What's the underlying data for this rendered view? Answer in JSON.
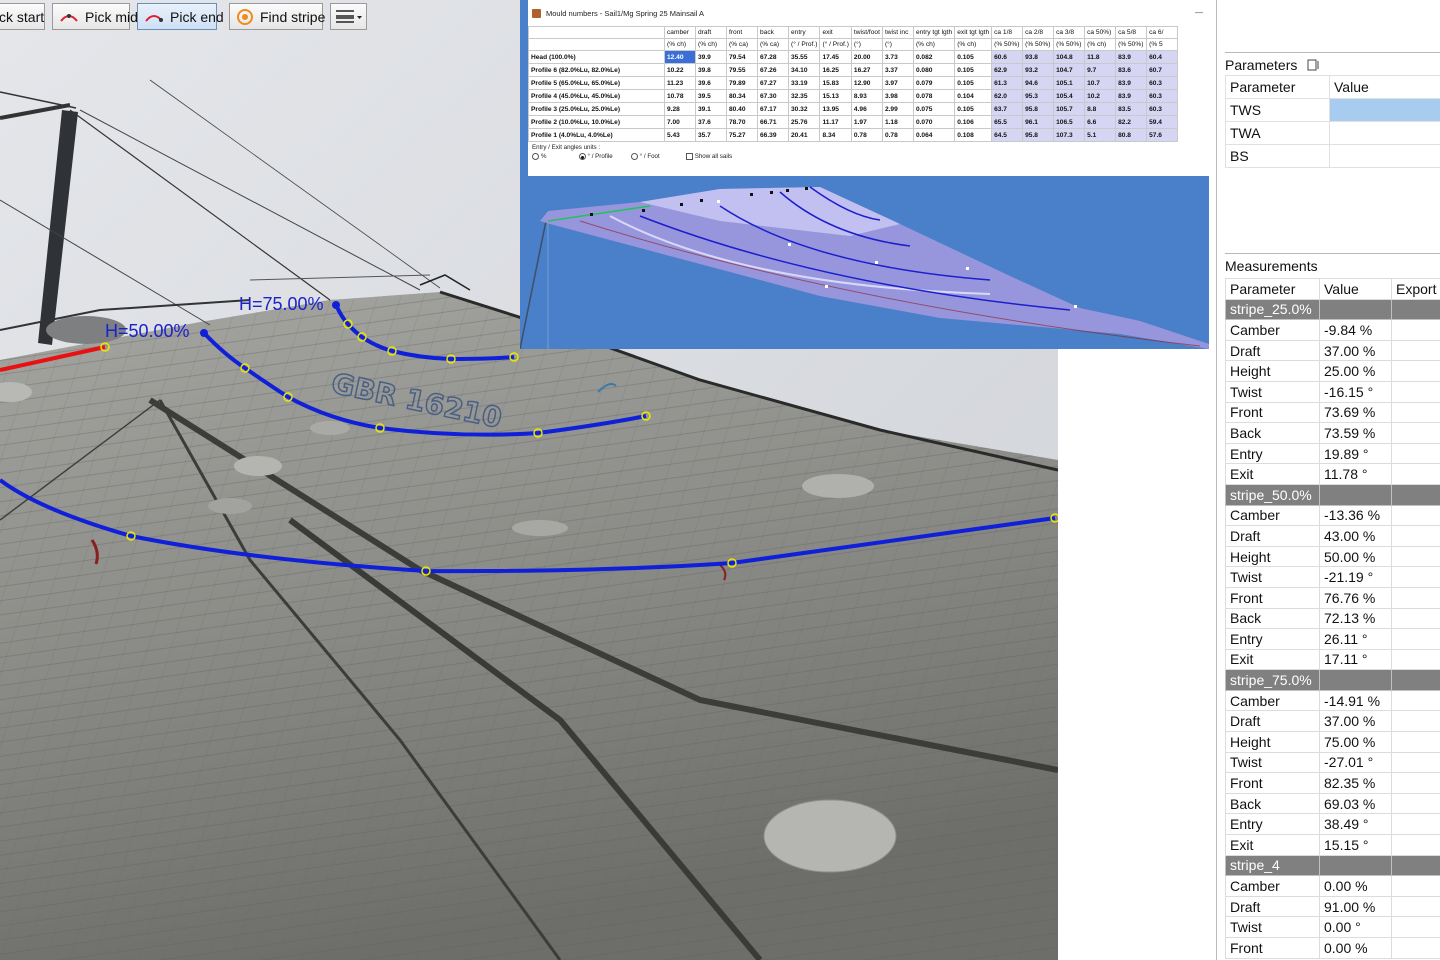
{
  "toolbar": {
    "buttons": [
      {
        "label": "ck start"
      },
      {
        "label": "Pick mid"
      },
      {
        "label": "Pick end",
        "active": true
      },
      {
        "label": "Find stripe"
      }
    ]
  },
  "overlay_labels": {
    "h50": "H=50.00%",
    "h75": "H=75.00%"
  },
  "sail_number_text": "GBR 16210",
  "colors": {
    "stripe_line": "#1020d8",
    "foot_line": "#e81010",
    "control_point": "#f2f200",
    "panel_group": "#808080",
    "selected_value": "#a8ccf0"
  },
  "mould_window": {
    "title": "Mould numbers - Sail1/Mg Spring 25 Mainsail A",
    "minimize": "—",
    "headers": [
      "camber",
      "draft",
      "front",
      "back",
      "entry",
      "exit",
      "twist/foot",
      "twist inc",
      "entry tgt lgth",
      "exit tgt lgth",
      "ca 1/8",
      "ca 2/8",
      "ca 3/8",
      "ca 50%)",
      "ca 5/8",
      "ca 6/"
    ],
    "units": [
      "(% ch)",
      "(% ch)",
      "(% ca)",
      "(% ca)",
      "(° / Prof.)",
      "(° / Prof.)",
      "(°)",
      "(°)",
      "(% ch)",
      "(% ch)",
      "(% 50%)",
      "(% 50%)",
      "(% 50%)",
      "(% ch)",
      "(% 50%)",
      "(% 5"
    ],
    "rows": [
      {
        "label": "Head (100.0%)",
        "values": [
          "12.40",
          "39.9",
          "79.54",
          "67.28",
          "35.55",
          "17.45",
          "20.00",
          "3.73",
          "0.082",
          "0.105",
          "60.6",
          "93.8",
          "104.8",
          "11.8",
          "83.9",
          "60.4"
        ]
      },
      {
        "label": "Profile 6 (82.0%Lu, 82.0%Le)",
        "values": [
          "10.22",
          "39.8",
          "79.55",
          "67.26",
          "34.10",
          "16.25",
          "16.27",
          "3.37",
          "0.080",
          "0.105",
          "62.9",
          "93.2",
          "104.7",
          "9.7",
          "83.6",
          "60.7"
        ]
      },
      {
        "label": "Profile 5 (65.0%Lu, 65.0%Le)",
        "values": [
          "11.23",
          "39.6",
          "79.89",
          "67.27",
          "33.19",
          "15.83",
          "12.90",
          "3.97",
          "0.079",
          "0.105",
          "61.3",
          "94.6",
          "105.1",
          "10.7",
          "83.9",
          "60.3"
        ]
      },
      {
        "label": "Profile 4 (45.0%Lu, 45.0%Le)",
        "values": [
          "10.78",
          "39.5",
          "80.34",
          "67.30",
          "32.35",
          "15.13",
          "8.93",
          "3.98",
          "0.078",
          "0.104",
          "62.0",
          "95.3",
          "105.4",
          "10.2",
          "83.9",
          "60.3"
        ]
      },
      {
        "label": "Profile 3 (25.0%Lu, 25.0%Le)",
        "values": [
          "9.28",
          "39.1",
          "80.40",
          "67.17",
          "30.32",
          "13.95",
          "4.96",
          "2.99",
          "0.075",
          "0.105",
          "63.7",
          "95.8",
          "105.7",
          "8.8",
          "83.5",
          "60.3"
        ]
      },
      {
        "label": "Profile 2 (10.0%Lu, 10.0%Le)",
        "values": [
          "7.00",
          "37.6",
          "78.70",
          "66.71",
          "25.76",
          "11.17",
          "1.97",
          "1.18",
          "0.070",
          "0.106",
          "65.5",
          "96.1",
          "106.5",
          "6.6",
          "82.2",
          "59.4"
        ]
      },
      {
        "label": "Profile 1 (4.0%Lu, 4.0%Le)",
        "values": [
          "5.43",
          "35.7",
          "75.27",
          "66.39",
          "20.41",
          "8.34",
          "0.78",
          "0.78",
          "0.064",
          "0.108",
          "64.5",
          "95.8",
          "107.3",
          "5.1",
          "80.8",
          "57.6"
        ]
      }
    ],
    "entry_exit_label": "Entry / Exit angles units :",
    "unit_options": [
      "%",
      "° / Profile",
      "° / Foot"
    ],
    "selected_unit": "° / Profile",
    "show_all_sails": "Show all sails"
  },
  "parameters_panel": {
    "title": "Parameters",
    "col_parameter": "Parameter",
    "col_value": "Value",
    "rows": [
      {
        "name": "TWS",
        "value": ""
      },
      {
        "name": "TWA",
        "value": ""
      },
      {
        "name": "BS",
        "value": ""
      }
    ]
  },
  "measurements_panel": {
    "title": "Measurements",
    "col_parameter": "Parameter",
    "col_value": "Value",
    "col_export": "Export",
    "groups": [
      {
        "name": "stripe_25.0%",
        "rows": [
          {
            "name": "Camber",
            "value": "-9.84 %"
          },
          {
            "name": "Draft",
            "value": "37.00 %"
          },
          {
            "name": "Height",
            "value": "25.00 %"
          },
          {
            "name": "Twist",
            "value": "-16.15 °"
          },
          {
            "name": "Front",
            "value": "73.69 %"
          },
          {
            "name": "Back",
            "value": "73.59 %"
          },
          {
            "name": "Entry",
            "value": "19.89 °"
          },
          {
            "name": "Exit",
            "value": "11.78 °"
          }
        ]
      },
      {
        "name": "stripe_50.0%",
        "rows": [
          {
            "name": "Camber",
            "value": "-13.36 %"
          },
          {
            "name": "Draft",
            "value": "43.00 %"
          },
          {
            "name": "Height",
            "value": "50.00 %"
          },
          {
            "name": "Twist",
            "value": "-21.19 °"
          },
          {
            "name": "Front",
            "value": "76.76 %"
          },
          {
            "name": "Back",
            "value": "72.13 %"
          },
          {
            "name": "Entry",
            "value": "26.11 °"
          },
          {
            "name": "Exit",
            "value": "17.11 °"
          }
        ]
      },
      {
        "name": "stripe_75.0%",
        "rows": [
          {
            "name": "Camber",
            "value": "-14.91 %"
          },
          {
            "name": "Draft",
            "value": "37.00 %"
          },
          {
            "name": "Height",
            "value": "75.00 %"
          },
          {
            "name": "Twist",
            "value": "-27.01 °"
          },
          {
            "name": "Front",
            "value": "82.35 %"
          },
          {
            "name": "Back",
            "value": "69.03 %"
          },
          {
            "name": "Entry",
            "value": "38.49 °"
          },
          {
            "name": "Exit",
            "value": "15.15 °"
          }
        ]
      },
      {
        "name": "stripe_4",
        "rows": [
          {
            "name": "Camber",
            "value": "0.00 %"
          },
          {
            "name": "Draft",
            "value": "91.00 %"
          },
          {
            "name": "Twist",
            "value": "0.00 °"
          },
          {
            "name": "Front",
            "value": "0.00 %"
          }
        ]
      }
    ]
  }
}
